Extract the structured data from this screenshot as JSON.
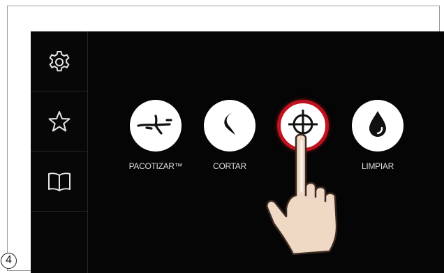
{
  "step_number": "4",
  "sidebar": {
    "items": [
      {
        "icon": "gear-icon"
      },
      {
        "icon": "star-icon"
      },
      {
        "icon": "book-icon"
      }
    ]
  },
  "modes": [
    {
      "label": "PACOTIZAR™",
      "icon": "pacotizar-blade-icon",
      "active": false
    },
    {
      "label": "CORTAR",
      "icon": "cut-blade-icon",
      "active": false
    },
    {
      "label": "",
      "icon": "crosshair-icon",
      "active": true
    },
    {
      "label": "LIMPIAR",
      "icon": "water-drop-icon",
      "active": false
    }
  ],
  "colors": {
    "screen_background": "#050505",
    "active_ring": "#c0121e",
    "label_text": "#dcdcdc"
  }
}
